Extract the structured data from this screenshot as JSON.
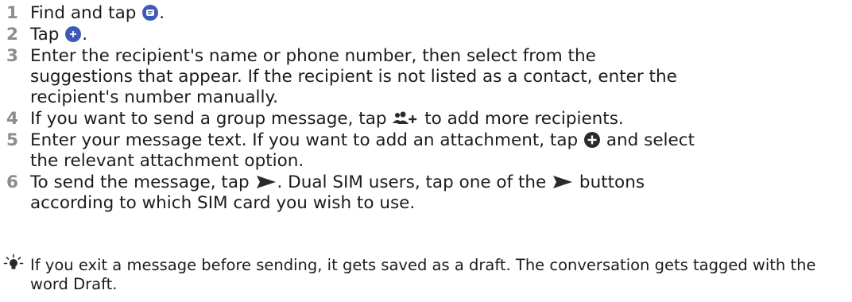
{
  "steps": [
    {
      "num": "1",
      "parts": [
        "Find and tap ",
        "."
      ]
    },
    {
      "num": "2",
      "parts": [
        "Tap ",
        "."
      ]
    },
    {
      "num": "3",
      "lines": [
        "Enter the recipient's name or phone number, then select from the",
        "suggestions that appear. If the recipient is not listed as a contact, enter the",
        "recipient's number manually."
      ]
    },
    {
      "num": "4",
      "parts": [
        "If you want to send a group message, tap ",
        " to add more recipients."
      ]
    },
    {
      "num": "5",
      "parts": [
        "Enter your message text. If you want to add an attachment, tap ",
        " and select"
      ],
      "line2": "the relevant attachment option."
    },
    {
      "num": "6",
      "parts": [
        "To send the message, tap ",
        ". Dual SIM users, tap one of the ",
        " buttons"
      ],
      "line2": "according to which SIM card you wish to use."
    }
  ],
  "tip": "If you exit a message before sending, it gets saved as a draft. The conversation gets tagged with the word Draft.",
  "icons": {
    "messages": "messages-app-icon",
    "new": "new-conversation-icon",
    "add_people": "add-people-icon",
    "attach": "add-attachment-icon",
    "send": "send-icon",
    "tip": "lightbulb-tip-icon"
  },
  "colors": {
    "icon_blue": "#3d5ab8",
    "icon_dark": "#2a2a2a",
    "number_gray": "#8c8c8c"
  }
}
